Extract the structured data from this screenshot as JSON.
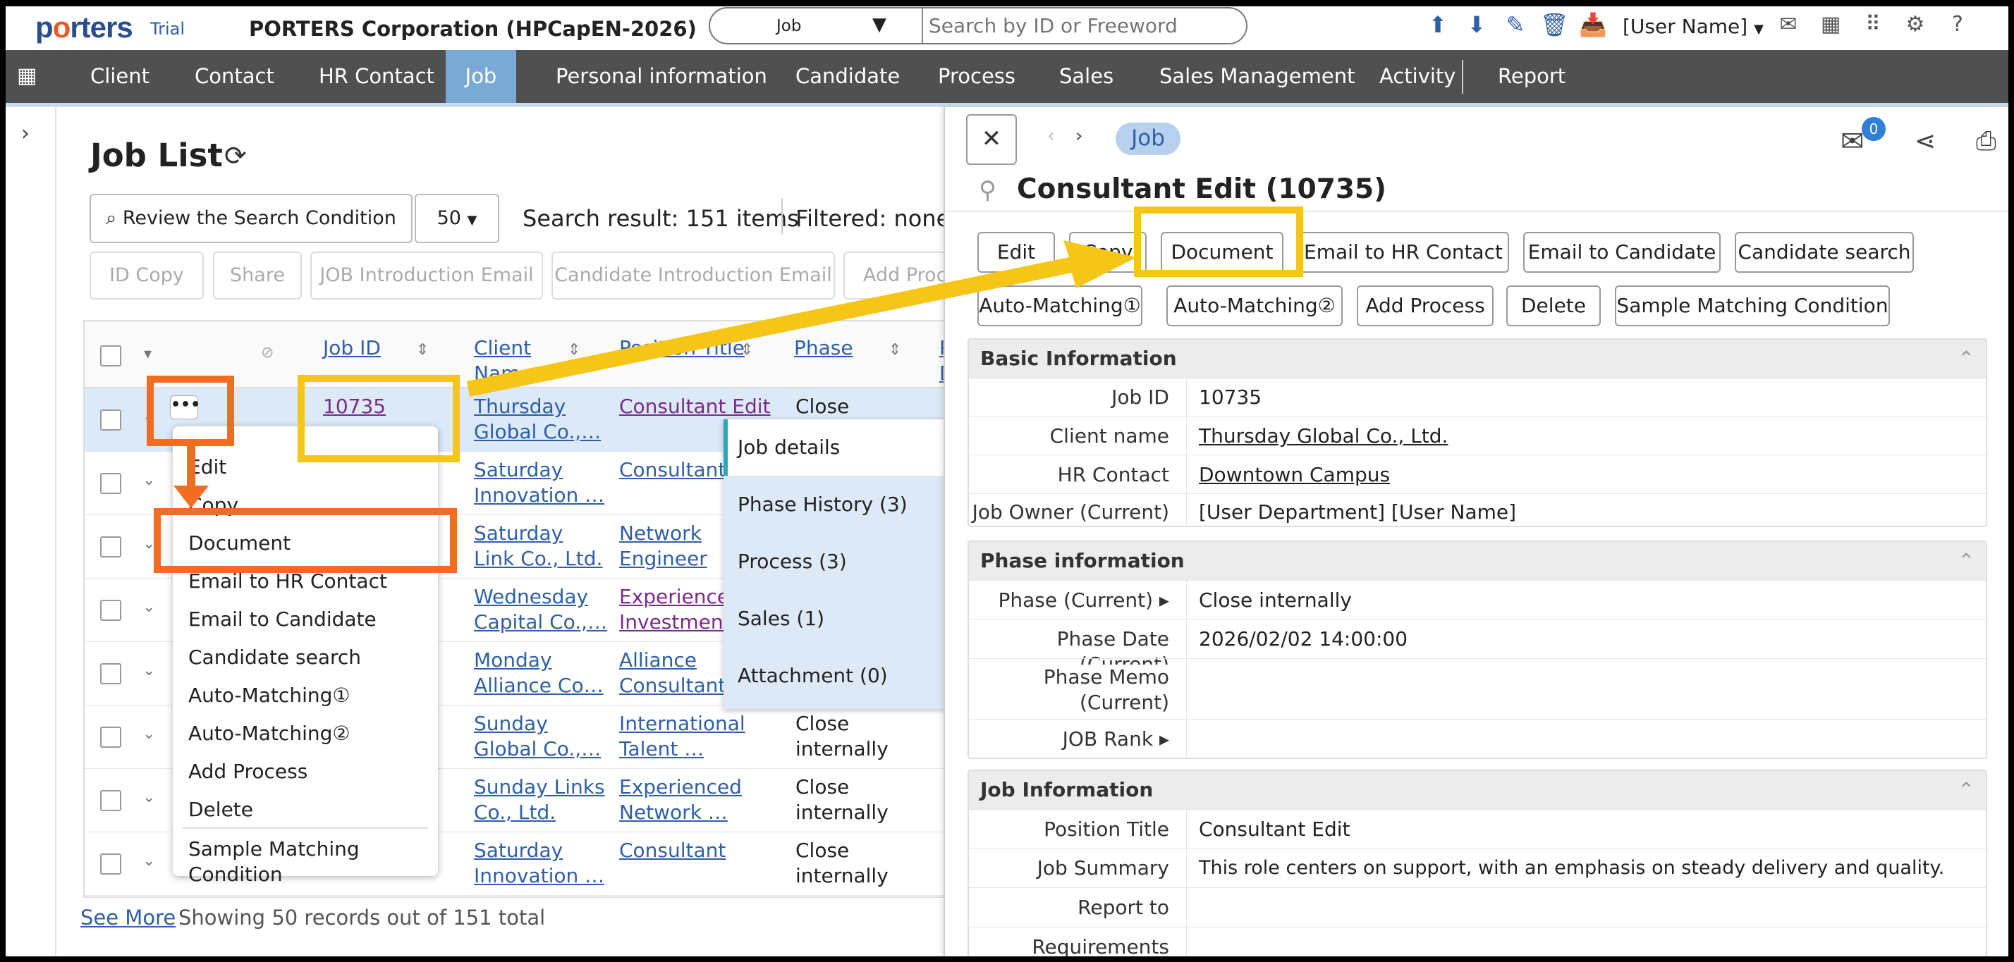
{
  "header": {
    "logo": "porters",
    "trial": "Trial",
    "corporation": "PORTERS Corporation (HPCapEN-2026)",
    "search_scope": "Job",
    "search_placeholder": "Search by ID or Freeword",
    "user_name": "[User Name]",
    "icons": [
      "upload-icon",
      "download-icon",
      "edit-note-icon",
      "trash-icon",
      "inbox-icon",
      "mail-icon",
      "calendar-icon",
      "apps-grid-icon",
      "gear-icon",
      "help-icon"
    ]
  },
  "nav": {
    "items": [
      "Client",
      "Contact",
      "HR Contact",
      "Job",
      "Personal information",
      "Candidate",
      "Process",
      "Sales",
      "Sales Management",
      "Activity",
      "Report"
    ],
    "active": "Job"
  },
  "list": {
    "title": "Job List",
    "review_button": "Review the Search Condition",
    "per_page": "50",
    "search_result": "Search result: 151 items",
    "filtered": "Filtered: none",
    "action_buttons": [
      "ID Copy",
      "Share",
      "JOB Introduction Email",
      "Candidate Introduction Email",
      "Add Proce"
    ],
    "columns": [
      "Job ID",
      "Client Name",
      "Position Title",
      "Phase",
      "P D"
    ],
    "rows": [
      {
        "job_id": "10735",
        "client": [
          "Thursday",
          "Global Co.,…"
        ],
        "position": [
          "Consultant Edit"
        ],
        "phase": [
          "Close"
        ]
      },
      {
        "job_id": "",
        "client": [
          "Saturday",
          "Innovation …"
        ],
        "position": [
          "Consultant"
        ],
        "phase": [
          ""
        ]
      },
      {
        "job_id": "",
        "client": [
          "Saturday",
          "Link Co., Ltd."
        ],
        "position": [
          "Network",
          "Engineer"
        ],
        "phase": [
          ""
        ]
      },
      {
        "job_id": "",
        "client": [
          "Wednesday",
          "Capital Co.,…"
        ],
        "position": [
          "Experienced",
          "Investment …"
        ],
        "phase": [
          ""
        ]
      },
      {
        "job_id": "",
        "client": [
          "Monday",
          "Alliance Co…"
        ],
        "position": [
          "Alliance",
          "Consultant"
        ],
        "phase": [
          ""
        ]
      },
      {
        "job_id": "",
        "client": [
          "Sunday",
          "Global Co.,…"
        ],
        "position": [
          "International",
          "Talent …"
        ],
        "phase": [
          "Close",
          "internally"
        ]
      },
      {
        "job_id": "",
        "client": [
          "Sunday Links",
          "Co., Ltd."
        ],
        "position": [
          "Experienced",
          "Network …"
        ],
        "phase": [
          "Close",
          "internally"
        ]
      },
      {
        "job_id": "",
        "client": [
          "Saturday",
          "Innovation …"
        ],
        "position": [
          "Consultant"
        ],
        "phase": [
          "Close",
          "internally"
        ]
      }
    ],
    "see_more": "See More",
    "showing": "Showing 50 records out of 151 total"
  },
  "context_menu": {
    "dots": "•••",
    "items": [
      "Edit",
      "Copy",
      "Document",
      "Email to HR Contact",
      "Email to Candidate",
      "Candidate search",
      "Auto-Matching①",
      "Auto-Matching②",
      "Add Process",
      "Delete",
      "Sample Matching Condition"
    ]
  },
  "hover_panel": {
    "items": [
      "Job details",
      "Phase History (3)",
      "Process (3)",
      "Sales (1)",
      "Attachment (0)"
    ]
  },
  "detail": {
    "pill": "Job",
    "mail_badge": "0",
    "title": "Consultant Edit (10735)",
    "buttons_row1": [
      "Edit",
      "Copy",
      "Document",
      "Email to HR Contact",
      "Email to Candidate",
      "Candidate search"
    ],
    "buttons_row2": [
      "Auto-Matching①",
      "Auto-Matching②",
      "Add Process",
      "Delete",
      "Sample Matching Condition"
    ],
    "basic": {
      "heading": "Basic Information",
      "fields": [
        {
          "label": "Job ID",
          "value": "10735"
        },
        {
          "label": "Client name",
          "value": "Thursday Global Co., Ltd."
        },
        {
          "label": "HR Contact",
          "value": "Downtown Campus"
        },
        {
          "label": "Job Owner (Current)",
          "value": "[User Department] [User Name]"
        }
      ]
    },
    "phase": {
      "heading": "Phase information",
      "fields": [
        {
          "label": "Phase (Current) ▸",
          "value": "Close internally"
        },
        {
          "label": "Phase Date (Current)",
          "value": "2026/02/02 14:00:00"
        },
        {
          "label": "Phase Memo",
          "label2": "(Current)",
          "value": ""
        },
        {
          "label": "JOB Rank ▸",
          "value": ""
        }
      ]
    },
    "job": {
      "heading": "Job Information",
      "fields": [
        {
          "label": "Position Title",
          "value": "Consultant Edit"
        },
        {
          "label": "Job Summary",
          "value": "This role centers on support, with an emphasis on steady delivery and quality."
        },
        {
          "label": "Report to",
          "value": ""
        },
        {
          "label": "Requirements",
          "value": ""
        }
      ]
    }
  },
  "colors": {
    "nav_bg": "#505050",
    "nav_active": "#7aa9d6",
    "link": "#2f5fa8",
    "highlight_yellow": "#f5c518",
    "highlight_orange": "#f26d21"
  }
}
